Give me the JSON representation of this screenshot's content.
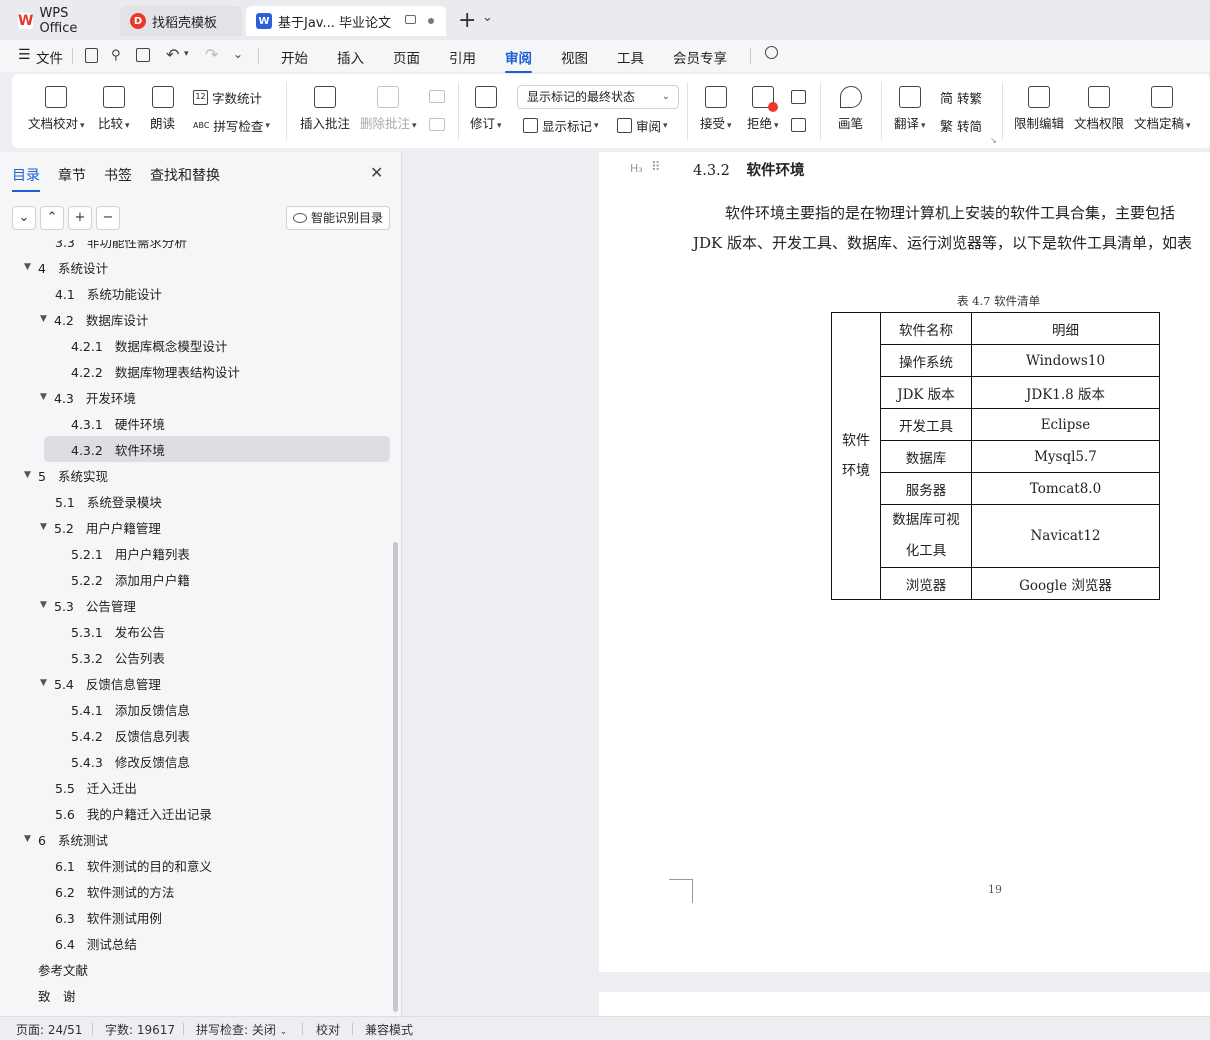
{
  "titlebar": {
    "tabs": [
      {
        "label": "WPS Office",
        "icon": "wps-logo-icon"
      },
      {
        "label": "找稻壳模板",
        "icon": "docer-icon"
      },
      {
        "label": "基于Jav... 毕业论文",
        "icon": "word-doc-icon"
      }
    ],
    "new_tab": "+",
    "new_tab_caret": "⌄"
  },
  "menubar": {
    "file": "文件",
    "items": [
      "开始",
      "插入",
      "页面",
      "引用",
      "审阅",
      "视图",
      "工具",
      "会员专享"
    ],
    "active": "审阅"
  },
  "ribbon": {
    "doc_compare": "文档校对",
    "compare": "比较",
    "read_aloud": "朗读",
    "word_count": "字数统计",
    "spell_check": "拼写检查",
    "insert_comment": "插入批注",
    "delete_comment": "删除批注",
    "track_changes": "修订",
    "markup_state": "显示标记的最终状态",
    "show_markup": "显示标记",
    "review": "审阅",
    "accept": "接受",
    "reject": "拒绝",
    "pen": "画笔",
    "translate": "翻译",
    "to_traditional": "转繁",
    "to_simplified": "转简",
    "restrict_edit": "限制编辑",
    "doc_permission": "文档权限",
    "doc_finalize": "文档定稿"
  },
  "panel": {
    "tabs": [
      "目录",
      "章节",
      "书签",
      "查找和替换"
    ],
    "smart_toc": "智能识别目录",
    "toc": [
      {
        "num": "3.3",
        "title": "非功能性需求分析",
        "level": 2,
        "arrow": false
      },
      {
        "num": "4",
        "title": "系统设计",
        "level": 1,
        "arrow": true
      },
      {
        "num": "4.1",
        "title": "系统功能设计",
        "level": 2,
        "arrow": false
      },
      {
        "num": "4.2",
        "title": "数据库设计",
        "level": 2,
        "arrow": true
      },
      {
        "num": "4.2.1",
        "title": "数据库概念模型设计",
        "level": 3,
        "arrow": false
      },
      {
        "num": "4.2.2",
        "title": "数据库物理表结构设计",
        "level": 3,
        "arrow": false
      },
      {
        "num": "4.3",
        "title": "开发环境",
        "level": 2,
        "arrow": true
      },
      {
        "num": "4.3.1",
        "title": "硬件环境",
        "level": 3,
        "arrow": false
      },
      {
        "num": "4.3.2",
        "title": "软件环境",
        "level": 3,
        "arrow": false,
        "selected": true
      },
      {
        "num": "5",
        "title": "系统实现",
        "level": 1,
        "arrow": true
      },
      {
        "num": "5.1",
        "title": "系统登录模块",
        "level": 2,
        "arrow": false
      },
      {
        "num": "5.2",
        "title": "用户户籍管理",
        "level": 2,
        "arrow": true
      },
      {
        "num": "5.2.1",
        "title": "用户户籍列表",
        "level": 3,
        "arrow": false
      },
      {
        "num": "5.2.2",
        "title": "添加用户户籍",
        "level": 3,
        "arrow": false
      },
      {
        "num": "5.3",
        "title": "公告管理",
        "level": 2,
        "arrow": true
      },
      {
        "num": "5.3.1",
        "title": "发布公告",
        "level": 3,
        "arrow": false
      },
      {
        "num": "5.3.2",
        "title": "公告列表",
        "level": 3,
        "arrow": false
      },
      {
        "num": "5.4",
        "title": "反馈信息管理",
        "level": 2,
        "arrow": true
      },
      {
        "num": "5.4.1",
        "title": "添加反馈信息",
        "level": 3,
        "arrow": false
      },
      {
        "num": "5.4.2",
        "title": "反馈信息列表",
        "level": 3,
        "arrow": false
      },
      {
        "num": "5.4.3",
        "title": "修改反馈信息",
        "level": 3,
        "arrow": false
      },
      {
        "num": "5.5",
        "title": "迁入迁出",
        "level": 2,
        "arrow": false
      },
      {
        "num": "5.6",
        "title": "我的户籍迁入迁出记录",
        "level": 2,
        "arrow": false
      },
      {
        "num": "6",
        "title": "系统测试",
        "level": 1,
        "arrow": true
      },
      {
        "num": "6.1",
        "title": "软件测试的目的和意义",
        "level": 2,
        "arrow": false
      },
      {
        "num": "6.2",
        "title": "软件测试的方法",
        "level": 2,
        "arrow": false
      },
      {
        "num": "6.3",
        "title": "软件测试用例",
        "level": 2,
        "arrow": false
      },
      {
        "num": "6.4",
        "title": "测试总结",
        "level": 2,
        "arrow": false
      },
      {
        "num": "",
        "title": "参考文献",
        "level": 0,
        "arrow": false
      },
      {
        "num": "",
        "title": "致　谢",
        "level": 0,
        "arrow": false
      }
    ]
  },
  "document": {
    "heading_marker": "H₃",
    "heading_num": "4.3.2",
    "heading_text": "软件环境",
    "para_line1": "软件环境主要指的是在物理计算机上安装的软件工具合集，主要包括",
    "para_line2": "JDK 版本、开发工具、数据库、运行浏览器等，以下是软件工具清单，如表",
    "table_caption": "表 4.7   软件清单",
    "table_group_label": "软件环境",
    "table_rows": [
      {
        "name": "软件名称",
        "detail": "明细"
      },
      {
        "name": "操作系统",
        "detail": "Windows10"
      },
      {
        "name": "JDK 版本",
        "detail": "JDK1.8 版本"
      },
      {
        "name": "开发工具",
        "detail": "Eclipse"
      },
      {
        "name": "数据库",
        "detail": "Mysql5.7"
      },
      {
        "name": "服务器",
        "detail": "Tomcat8.0"
      },
      {
        "name": "数据库可视化工具",
        "detail": "Navicat12"
      },
      {
        "name": "浏览器",
        "detail": "Google 浏览器"
      }
    ],
    "page_number": "19"
  },
  "statusbar": {
    "page": "页面: 24/51",
    "words": "字数: 19617",
    "spell": "拼写检查: 关闭",
    "proofread": "校对",
    "compat": "兼容模式"
  },
  "colors": {
    "accent": "#1f5fd6",
    "wps_red": "#e8392c",
    "word_blue": "#2b5fd9"
  }
}
